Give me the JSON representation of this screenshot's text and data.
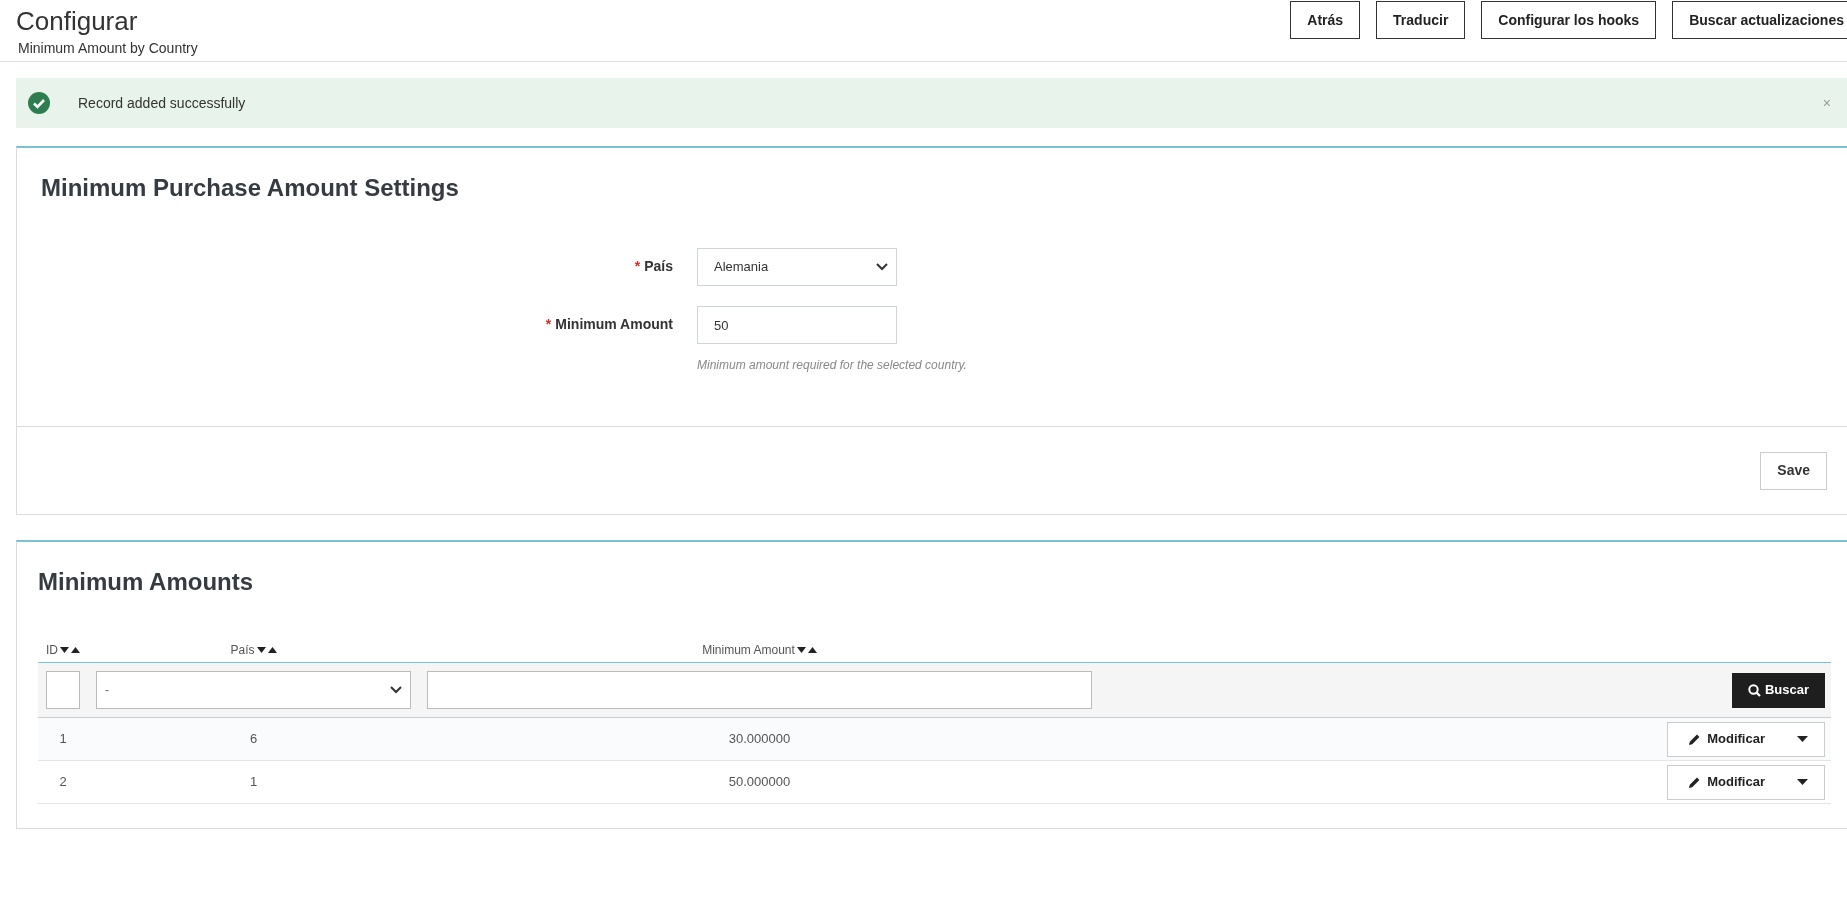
{
  "header": {
    "title": "Configurar",
    "subtitle": "Minimum Amount by Country",
    "buttons": [
      "Atrás",
      "Traducir",
      "Configurar los hooks",
      "Buscar actualizaciones"
    ]
  },
  "alert": {
    "kind": "success",
    "message": "Record added successfully",
    "close": "×"
  },
  "settings_panel": {
    "title": "Minimum Purchase Amount Settings",
    "fields": [
      {
        "kind": "select",
        "marker": "*",
        "label": "País",
        "value": "Alemania"
      },
      {
        "kind": "input",
        "marker": "*",
        "label": "Minimum Amount",
        "value": "50",
        "help": "Minimum amount required for the selected country."
      }
    ],
    "save_button": "Save"
  },
  "list_panel": {
    "title": "Minimum Amounts",
    "columns": [
      {
        "label": "ID"
      },
      {
        "label": "País"
      },
      {
        "label": "Minimum Amount"
      }
    ],
    "filters": [
      {
        "kind": "input"
      },
      {
        "kind": "select",
        "value": "-"
      },
      {
        "kind": "input"
      }
    ],
    "search_button": "Buscar",
    "rows": [
      {
        "cells": [
          "1",
          "6",
          "30.000000"
        ],
        "action": "Modificar"
      },
      {
        "cells": [
          "2",
          "1",
          "50.000000"
        ],
        "action": "Modificar"
      }
    ]
  }
}
